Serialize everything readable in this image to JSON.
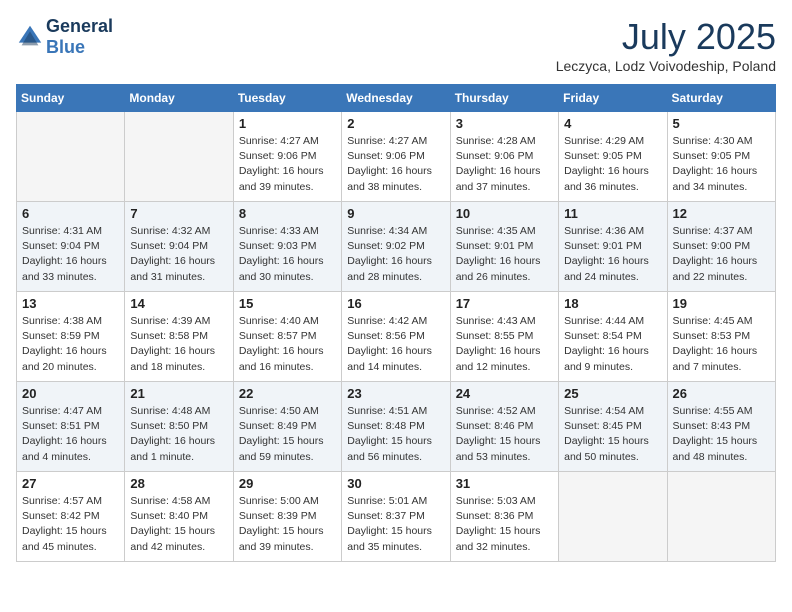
{
  "header": {
    "logo_line1": "General",
    "logo_line2": "Blue",
    "month": "July 2025",
    "location": "Leczyca, Lodz Voivodeship, Poland"
  },
  "weekdays": [
    "Sunday",
    "Monday",
    "Tuesday",
    "Wednesday",
    "Thursday",
    "Friday",
    "Saturday"
  ],
  "weeks": [
    [
      {
        "day": "",
        "info": ""
      },
      {
        "day": "",
        "info": ""
      },
      {
        "day": "1",
        "info": "Sunrise: 4:27 AM\nSunset: 9:06 PM\nDaylight: 16 hours\nand 39 minutes."
      },
      {
        "day": "2",
        "info": "Sunrise: 4:27 AM\nSunset: 9:06 PM\nDaylight: 16 hours\nand 38 minutes."
      },
      {
        "day": "3",
        "info": "Sunrise: 4:28 AM\nSunset: 9:06 PM\nDaylight: 16 hours\nand 37 minutes."
      },
      {
        "day": "4",
        "info": "Sunrise: 4:29 AM\nSunset: 9:05 PM\nDaylight: 16 hours\nand 36 minutes."
      },
      {
        "day": "5",
        "info": "Sunrise: 4:30 AM\nSunset: 9:05 PM\nDaylight: 16 hours\nand 34 minutes."
      }
    ],
    [
      {
        "day": "6",
        "info": "Sunrise: 4:31 AM\nSunset: 9:04 PM\nDaylight: 16 hours\nand 33 minutes."
      },
      {
        "day": "7",
        "info": "Sunrise: 4:32 AM\nSunset: 9:04 PM\nDaylight: 16 hours\nand 31 minutes."
      },
      {
        "day": "8",
        "info": "Sunrise: 4:33 AM\nSunset: 9:03 PM\nDaylight: 16 hours\nand 30 minutes."
      },
      {
        "day": "9",
        "info": "Sunrise: 4:34 AM\nSunset: 9:02 PM\nDaylight: 16 hours\nand 28 minutes."
      },
      {
        "day": "10",
        "info": "Sunrise: 4:35 AM\nSunset: 9:01 PM\nDaylight: 16 hours\nand 26 minutes."
      },
      {
        "day": "11",
        "info": "Sunrise: 4:36 AM\nSunset: 9:01 PM\nDaylight: 16 hours\nand 24 minutes."
      },
      {
        "day": "12",
        "info": "Sunrise: 4:37 AM\nSunset: 9:00 PM\nDaylight: 16 hours\nand 22 minutes."
      }
    ],
    [
      {
        "day": "13",
        "info": "Sunrise: 4:38 AM\nSunset: 8:59 PM\nDaylight: 16 hours\nand 20 minutes."
      },
      {
        "day": "14",
        "info": "Sunrise: 4:39 AM\nSunset: 8:58 PM\nDaylight: 16 hours\nand 18 minutes."
      },
      {
        "day": "15",
        "info": "Sunrise: 4:40 AM\nSunset: 8:57 PM\nDaylight: 16 hours\nand 16 minutes."
      },
      {
        "day": "16",
        "info": "Sunrise: 4:42 AM\nSunset: 8:56 PM\nDaylight: 16 hours\nand 14 minutes."
      },
      {
        "day": "17",
        "info": "Sunrise: 4:43 AM\nSunset: 8:55 PM\nDaylight: 16 hours\nand 12 minutes."
      },
      {
        "day": "18",
        "info": "Sunrise: 4:44 AM\nSunset: 8:54 PM\nDaylight: 16 hours\nand 9 minutes."
      },
      {
        "day": "19",
        "info": "Sunrise: 4:45 AM\nSunset: 8:53 PM\nDaylight: 16 hours\nand 7 minutes."
      }
    ],
    [
      {
        "day": "20",
        "info": "Sunrise: 4:47 AM\nSunset: 8:51 PM\nDaylight: 16 hours\nand 4 minutes."
      },
      {
        "day": "21",
        "info": "Sunrise: 4:48 AM\nSunset: 8:50 PM\nDaylight: 16 hours\nand 1 minute."
      },
      {
        "day": "22",
        "info": "Sunrise: 4:50 AM\nSunset: 8:49 PM\nDaylight: 15 hours\nand 59 minutes."
      },
      {
        "day": "23",
        "info": "Sunrise: 4:51 AM\nSunset: 8:48 PM\nDaylight: 15 hours\nand 56 minutes."
      },
      {
        "day": "24",
        "info": "Sunrise: 4:52 AM\nSunset: 8:46 PM\nDaylight: 15 hours\nand 53 minutes."
      },
      {
        "day": "25",
        "info": "Sunrise: 4:54 AM\nSunset: 8:45 PM\nDaylight: 15 hours\nand 50 minutes."
      },
      {
        "day": "26",
        "info": "Sunrise: 4:55 AM\nSunset: 8:43 PM\nDaylight: 15 hours\nand 48 minutes."
      }
    ],
    [
      {
        "day": "27",
        "info": "Sunrise: 4:57 AM\nSunset: 8:42 PM\nDaylight: 15 hours\nand 45 minutes."
      },
      {
        "day": "28",
        "info": "Sunrise: 4:58 AM\nSunset: 8:40 PM\nDaylight: 15 hours\nand 42 minutes."
      },
      {
        "day": "29",
        "info": "Sunrise: 5:00 AM\nSunset: 8:39 PM\nDaylight: 15 hours\nand 39 minutes."
      },
      {
        "day": "30",
        "info": "Sunrise: 5:01 AM\nSunset: 8:37 PM\nDaylight: 15 hours\nand 35 minutes."
      },
      {
        "day": "31",
        "info": "Sunrise: 5:03 AM\nSunset: 8:36 PM\nDaylight: 15 hours\nand 32 minutes."
      },
      {
        "day": "",
        "info": ""
      },
      {
        "day": "",
        "info": ""
      }
    ]
  ]
}
